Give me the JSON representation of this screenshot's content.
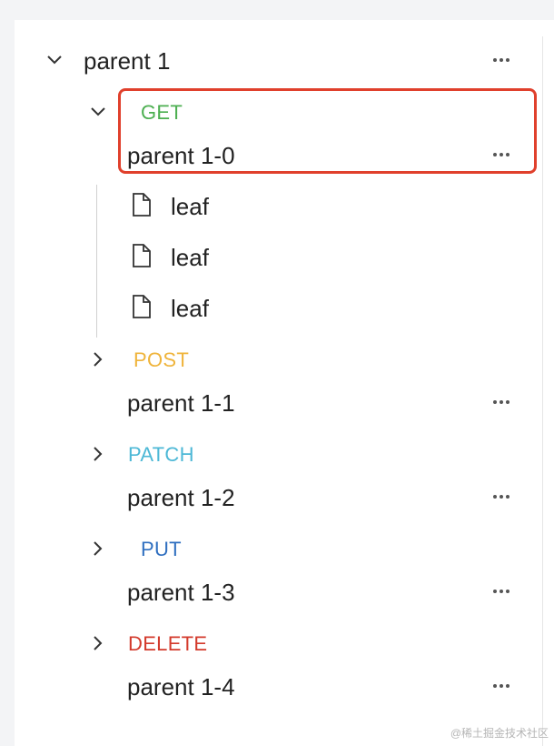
{
  "colors": {
    "get": "#4caf50",
    "post": "#efb43b",
    "patch": "#4db8d6",
    "put": "#2f6fc0",
    "delete": "#d33a2c",
    "highlight": "#e0402c"
  },
  "tree": {
    "root": {
      "title": "parent 1",
      "expanded": true,
      "more_icon": "ellipsis-icon"
    },
    "children": [
      {
        "method": "GET",
        "title": "parent 1-0",
        "expanded": true,
        "leaves": [
          {
            "label": "leaf",
            "icon": "file-icon"
          },
          {
            "label": "leaf",
            "icon": "file-icon"
          },
          {
            "label": "leaf",
            "icon": "file-icon"
          }
        ]
      },
      {
        "method": "POST",
        "title": "parent 1-1",
        "expanded": false
      },
      {
        "method": "PATCH",
        "title": "parent 1-2",
        "expanded": false
      },
      {
        "method": "PUT",
        "title": "parent 1-3",
        "expanded": false
      },
      {
        "method": "DELETE",
        "title": "parent 1-4",
        "expanded": false
      }
    ]
  },
  "watermark": "@稀土掘金技术社区"
}
